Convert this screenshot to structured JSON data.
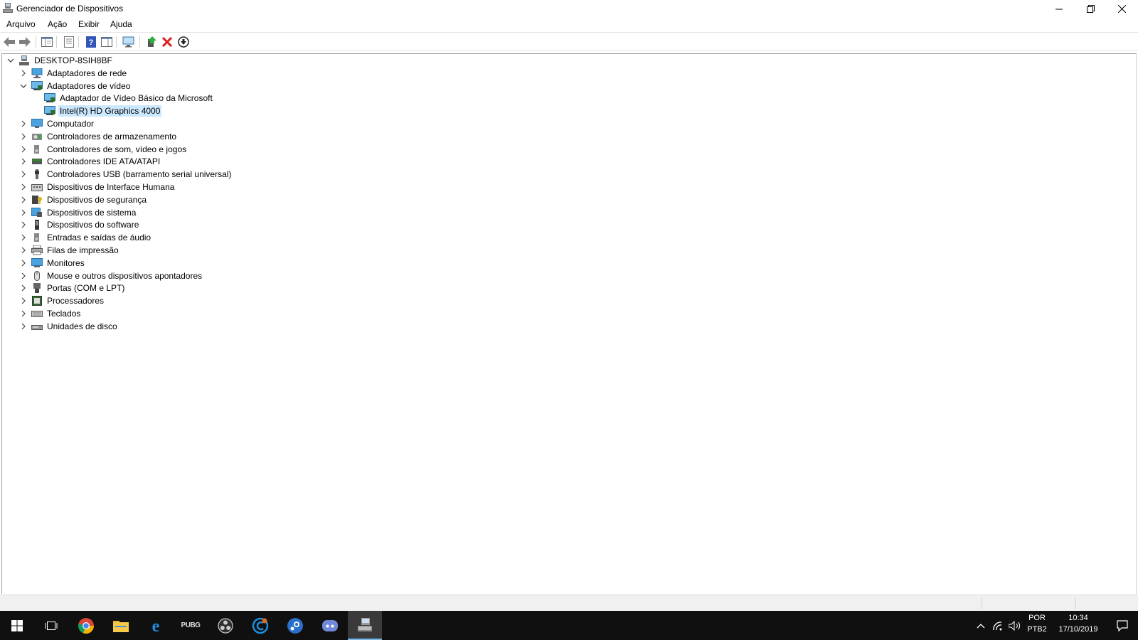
{
  "window": {
    "title": "Gerenciador de Dispositivos",
    "icon": "device-manager-icon",
    "controls": [
      "minimize-icon",
      "restore-icon",
      "close-icon"
    ]
  },
  "menu": [
    "Arquivo",
    "Ação",
    "Exibir",
    "Ajuda"
  ],
  "toolbar": [
    "back-icon",
    "forward-icon",
    "show-hide-tree-icon",
    "properties-icon",
    "help-icon",
    "action-pane-icon",
    "scan-hardware-icon",
    "update-driver-icon",
    "uninstall-icon",
    "disable-device-icon"
  ],
  "tree": {
    "root": "DESKTOP-8SIH8BF",
    "nodes": [
      {
        "label": "Adaptadores de rede",
        "icon": "network-adapter-icon"
      },
      {
        "label": "Adaptadores de vídeo",
        "icon": "display-adapter-icon",
        "expanded": true,
        "children": [
          {
            "label": "Adaptador de Vídeo Básico da Microsoft",
            "icon": "display-adapter-icon"
          },
          {
            "label": "Intel(R) HD Graphics 4000",
            "icon": "display-adapter-icon",
            "selected": true
          }
        ]
      },
      {
        "label": "Computador",
        "icon": "computer-icon"
      },
      {
        "label": "Controladores de armazenamento",
        "icon": "storage-controller-icon"
      },
      {
        "label": "Controladores de som, vídeo e jogos",
        "icon": "speaker-icon"
      },
      {
        "label": "Controladores IDE ATA/ATAPI",
        "icon": "ide-controller-icon"
      },
      {
        "label": "Controladores USB (barramento serial universal)",
        "icon": "usb-icon"
      },
      {
        "label": "Dispositivos de Interface Humana",
        "icon": "hid-icon"
      },
      {
        "label": "Dispositivos de segurança",
        "icon": "security-device-icon"
      },
      {
        "label": "Dispositivos de sistema",
        "icon": "system-device-icon"
      },
      {
        "label": "Dispositivos do software",
        "icon": "software-device-icon"
      },
      {
        "label": "Entradas e saídas de áudio",
        "icon": "audio-io-icon"
      },
      {
        "label": "Filas de impressão",
        "icon": "printer-icon"
      },
      {
        "label": "Monitores",
        "icon": "monitor-icon"
      },
      {
        "label": "Mouse e outros dispositivos apontadores",
        "icon": "mouse-icon"
      },
      {
        "label": "Portas (COM e LPT)",
        "icon": "port-icon"
      },
      {
        "label": "Processadores",
        "icon": "processor-icon"
      },
      {
        "label": "Teclados",
        "icon": "keyboard-icon"
      },
      {
        "label": "Unidades de disco",
        "icon": "disk-drive-icon"
      }
    ]
  },
  "taskbar": {
    "apps": [
      "start-icon",
      "task-view-icon",
      "chrome-icon",
      "file-explorer-icon",
      "edge-icon",
      "pubg-icon",
      "obs-icon",
      "ccleaner-icon",
      "steam-icon",
      "discord-icon",
      "device-manager-icon"
    ],
    "pubg_label": "PUBG",
    "tray": {
      "icons": [
        "chevron-up-icon",
        "wifi-icon",
        "volume-icon"
      ],
      "lang": "POR",
      "layout": "PTB2",
      "time": "10:34",
      "date": "17/10/2019",
      "notification_icon": "notification-icon"
    }
  },
  "colors": {
    "selection": "#cce8ff",
    "taskbar": "#101010",
    "accent": "#76b9ed"
  }
}
